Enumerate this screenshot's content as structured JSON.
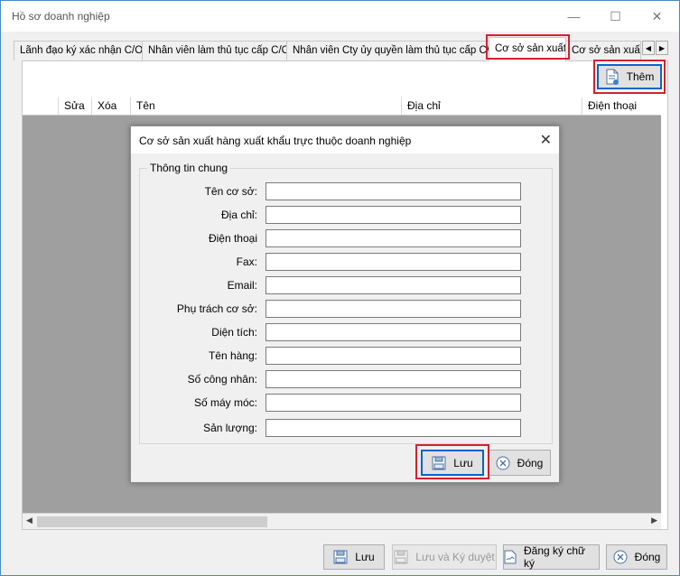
{
  "window": {
    "title": "Hồ sơ doanh nghiệp",
    "minimize": "—",
    "maximize": "☐",
    "close": "✕"
  },
  "tabs": [
    {
      "label": "Lãnh đạo ký xác nhận C/O"
    },
    {
      "label": "Nhân viên làm thủ tục cấp C/O"
    },
    {
      "label": "Nhân viên Cty ủy quyền làm thủ tục cấp C/O"
    },
    {
      "label": "Cơ sở sản xuất"
    },
    {
      "label": "Cơ sở sản xuất c"
    }
  ],
  "tab_scroll": {
    "left": "◀",
    "right": "▶"
  },
  "add_button": {
    "label": "Thêm",
    "icon": "document-add-icon"
  },
  "grid": {
    "columns": [
      "",
      "Sửa",
      "Xóa",
      "Tên",
      "Địa chỉ",
      "Điện thoại"
    ]
  },
  "scroll_arrows": {
    "left": "◀",
    "right": "▶"
  },
  "dialog": {
    "title": "Cơ sở sản xuất hàng xuất khẩu trực thuộc doanh nghiệp",
    "close": "✕",
    "group_label": "Thông tin chung",
    "fields": [
      {
        "label": "Tên cơ sở:",
        "value": ""
      },
      {
        "label": "Địa chỉ:",
        "value": ""
      },
      {
        "label": "Điện thoại",
        "value": ""
      },
      {
        "label": "Fax:",
        "value": ""
      },
      {
        "label": "Email:",
        "value": ""
      },
      {
        "label": "Phụ trách cơ sở:",
        "value": ""
      },
      {
        "label": "Diện tích:",
        "value": ""
      },
      {
        "label": "Tên hàng:",
        "value": ""
      },
      {
        "label": "Số công nhân:",
        "value": ""
      },
      {
        "label": "Số máy móc:",
        "value": ""
      },
      {
        "label": "Sản lượng:",
        "value": ""
      }
    ],
    "save_button": {
      "label": "Lưu",
      "icon": "floppy-disk-icon"
    },
    "close_button": {
      "label": "Đóng",
      "icon": "circle-x-icon"
    }
  },
  "footer": {
    "save": {
      "label": "Lưu"
    },
    "save_approve": {
      "label": "Lưu và Ký duyệt"
    },
    "register_signature": {
      "label": "Đăng ký chữ ký"
    },
    "close": {
      "label": "Đóng"
    }
  },
  "colors": {
    "highlight": "#d32030",
    "grid_background": "#9f9f9f",
    "focus_border": "#0a64c8"
  }
}
